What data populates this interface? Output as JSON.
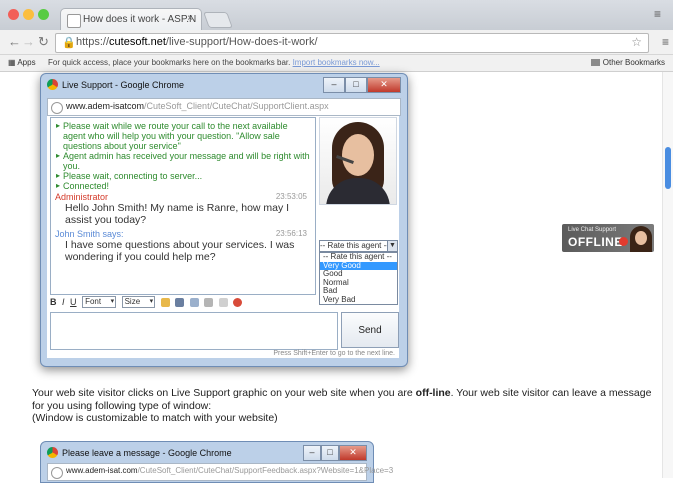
{
  "browser": {
    "tab_title": "How does it work - ASP.N",
    "tab_close": "×",
    "url_host": "cutesoft.net",
    "url_prefix": "https://",
    "url_path": "/live-support/How-does-it-work/",
    "apps_label": "Apps",
    "bookmarks_hint": "For quick access, place your bookmarks here on the bookmarks bar.",
    "bookmarks_import_link": "Import bookmarks now...",
    "other_bookmarks": "Other Bookmarks"
  },
  "popup": {
    "title": "Live Support - Google Chrome",
    "url_host": "www.adem-isatcom",
    "url_path": "/CuteSoft_Client/CuteChat/SupportClient.aspx",
    "system_lines": [
      "Please wait while we route your call to the next available agent who will help you with your question. \"Allow sale questions about your service\"",
      "Agent admin has received your message and will be right with you.",
      "Please wait, connecting to server...",
      "Connected!"
    ],
    "agent_name": "Administrator",
    "agent_time": "23:53:05",
    "agent_message": "Hello John Smith! My name is Ranre, how may I assist you today?",
    "visitor_name": "John Smith says:",
    "visitor_time": "23:56:13",
    "visitor_message": "I have some questions about your services. I was wondering if you could help me?",
    "rating_select": "-- Rate this agent --",
    "rating_options": [
      "-- Rate this agent --",
      "Very Good",
      "Good",
      "Normal",
      "Bad",
      "Very Bad"
    ],
    "rating_selected_index": 1,
    "format_bold": "B",
    "format_italic": "I",
    "format_underline": "U",
    "font_select": "Font",
    "size_select": "Size",
    "send_label": "Send",
    "footer_text": "Press Shift+Enter to go to the next line."
  },
  "offline_badge": {
    "small": "Live Chat Support",
    "big": "OFFLINE"
  },
  "page": {
    "para1_prefix": "Your web site visitor clicks on Live Support graphic on your web site when you are ",
    "para1_bold": "off-line",
    "para1_suffix": ". Your web site visitor can leave a message for you using following type of window:",
    "para2": "(Window is customizable to match with your website)"
  },
  "popup2": {
    "title": "Please leave a message - Google Chrome",
    "url_host": "www.adem-isat.com",
    "url_path": "/CuteSoft_Client/CuteChat/SupportFeedback.aspx?Website=1&Place=3"
  },
  "colors": {
    "system_text": "#2e8b2e",
    "agent_name": "#d43a2a",
    "visitor_name": "#5a8ad6",
    "scroll_thumb": "#4a8de1",
    "dropdown_selected": "#3399ff",
    "offline_dot": "#e23b2e"
  },
  "icons": {
    "back": "back-arrow-icon",
    "forward": "forward-arrow-icon",
    "reload": "reload-icon",
    "lock": "lock-icon",
    "star": "star-icon",
    "menu": "hamburger-menu-icon"
  }
}
